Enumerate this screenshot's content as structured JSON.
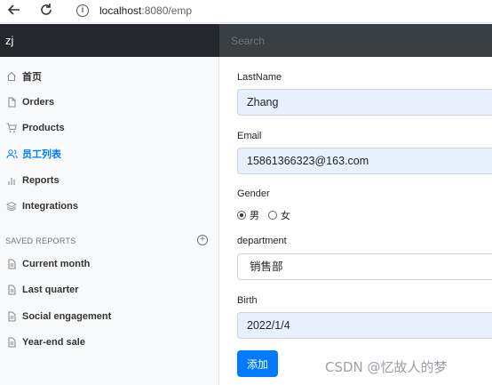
{
  "browser": {
    "url_host": "localhost",
    "url_path": ":8080/emp"
  },
  "navbar": {
    "brand": "zj",
    "search_placeholder": "Search"
  },
  "sidebar": {
    "items": [
      {
        "label": "首页",
        "icon": "home-icon"
      },
      {
        "label": "Orders",
        "icon": "file-icon"
      },
      {
        "label": "Products",
        "icon": "shopping-cart-icon"
      },
      {
        "label": "员工列表",
        "icon": "users-icon",
        "active": true
      },
      {
        "label": "Reports",
        "icon": "bar-chart-icon"
      },
      {
        "label": "Integrations",
        "icon": "layers-icon"
      }
    ],
    "section_title": "SAVED REPORTS",
    "reports": [
      {
        "label": "Current month",
        "icon": "file-text-icon"
      },
      {
        "label": "Last quarter",
        "icon": "file-text-icon"
      },
      {
        "label": "Social engagement",
        "icon": "file-text-icon"
      },
      {
        "label": "Year-end sale",
        "icon": "file-text-icon"
      }
    ]
  },
  "form": {
    "lastname_label": "LastName",
    "lastname_value": "Zhang",
    "email_label": "Email",
    "email_value": "15861366323@163.com",
    "gender_label": "Gender",
    "gender_options": [
      "男",
      "女"
    ],
    "gender_selected": "男",
    "department_label": "department",
    "department_value": "销售部",
    "birth_label": "Birth",
    "birth_value": "2022/1/4",
    "submit_label": "添加"
  },
  "watermark": "CSDN @忆故人的梦",
  "colors": {
    "primary": "#007bff",
    "navbar": "#343a40",
    "autofill": "#e8f0fe"
  }
}
